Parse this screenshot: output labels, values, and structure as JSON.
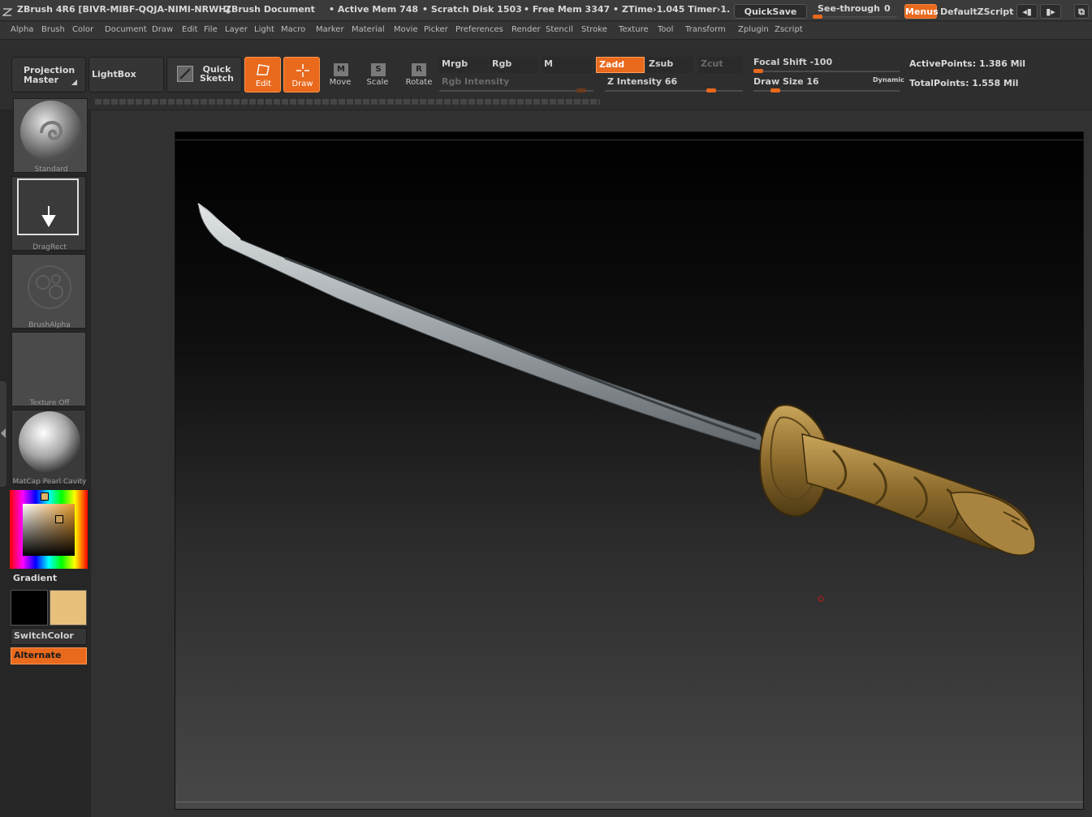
{
  "titlebar": {
    "app": "ZBrush 4R6 [BIVR-MIBF-QQJA-NIMI-NRWH]",
    "document": "ZBrush Document",
    "active_mem": "• Active Mem 748",
    "scratch_disk": "• Scratch Disk 1503",
    "free_mem": "• Free Mem 3347",
    "ztime": "• ZTime›1.045 Timer›1.",
    "quicksave": "QuickSave",
    "see_through_label": "See-through",
    "see_through_value": "0",
    "menus": "Menus",
    "script": "DefaultZScript"
  },
  "menu": [
    "Alpha",
    "Brush",
    "Color",
    "Document",
    "Draw",
    "Edit",
    "File",
    "Layer",
    "Light",
    "Macro",
    "Marker",
    "Material",
    "Movie",
    "Picker",
    "Preferences",
    "Render",
    "Stencil",
    "Stroke",
    "Texture",
    "Tool",
    "Transform",
    "Zplugin",
    "Zscript"
  ],
  "toolbar": {
    "projection_master": "Projection Master",
    "lightbox": "LightBox",
    "quick_sketch": "Quick Sketch",
    "edit": "Edit",
    "draw": "Draw",
    "move": "Move",
    "scale": "Scale",
    "rotate": "Rotate",
    "move_key": "M",
    "scale_key": "S",
    "rotate_key": "R",
    "mrgb": "Mrgb",
    "rgb": "Rgb",
    "m": "M",
    "zadd": "Zadd",
    "zsub": "Zsub",
    "zcut": "Zcut",
    "rgb_intensity": "Rgb Intensity",
    "z_intensity": "Z Intensity 66",
    "focal_shift": "Focal Shift -100",
    "draw_size": "Draw Size 16",
    "dynamic": "Dynamic",
    "active_points": "ActivePoints: 1.386 Mil",
    "total_points": "TotalPoints: 1.558 Mil"
  },
  "sliders": {
    "rgb_intensity": 1,
    "z_intensity": 0.66,
    "focal_shift": -100,
    "draw_size": 16
  },
  "tray": {
    "brush": "Standard",
    "stroke": "DragRect",
    "alpha": "BrushAlpha",
    "texture": "Texture Off",
    "material": "MatCap Pearl Cavity",
    "gradient": "Gradient",
    "switch_color": "SwitchColor",
    "alternate": "Alternate"
  },
  "colors": {
    "accent": "#e9691d",
    "primary_color": "#000000",
    "secondary_color": "#e8c07c",
    "blade": "#b9bec2",
    "hilt": "#9c7a35"
  }
}
